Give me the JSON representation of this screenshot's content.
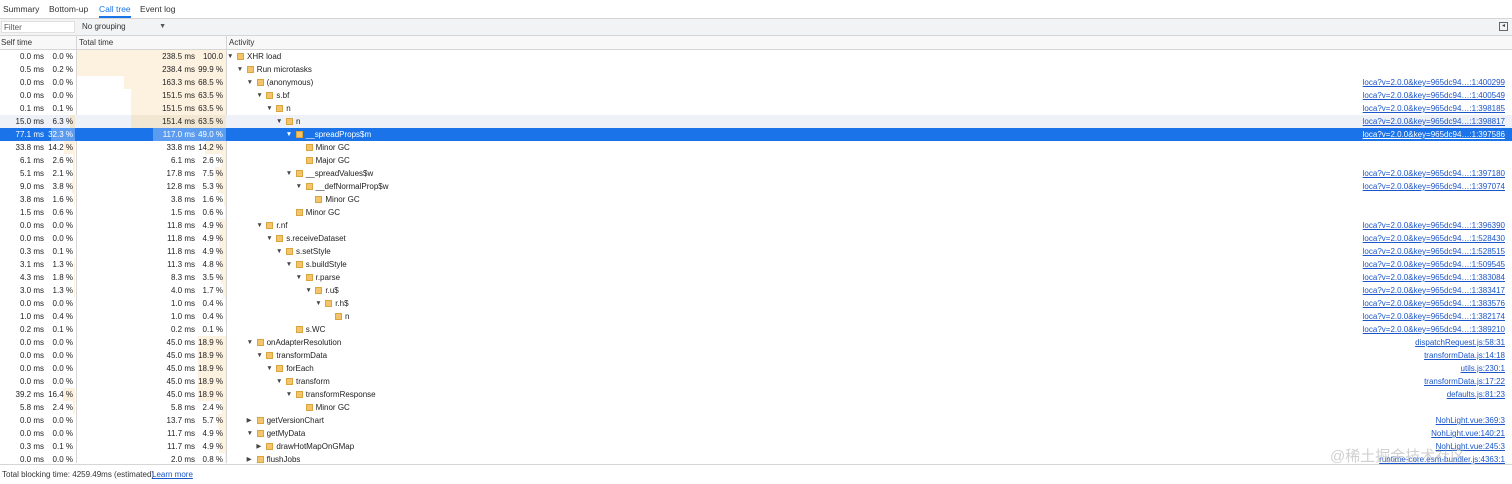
{
  "tabs": [
    {
      "label": "Summary",
      "active": false
    },
    {
      "label": "Bottom-up",
      "active": false
    },
    {
      "label": "Call tree",
      "active": true
    },
    {
      "label": "Event log",
      "active": false
    }
  ],
  "filter": {
    "placeholder": "Filter"
  },
  "grouping": {
    "value": "No grouping"
  },
  "columns": {
    "self": "Self time",
    "total": "Total time",
    "activity": "Activity"
  },
  "rows": [
    {
      "self_ms": "0.0 ms",
      "self_pct": "0.0 %",
      "self_frac": 0,
      "total_ms": "238.5 ms",
      "total_pct": "100.0 %",
      "total_frac": 1.0,
      "depth": 0,
      "expand": "open",
      "name": "XHR load",
      "link": ""
    },
    {
      "self_ms": "0.5 ms",
      "self_pct": "0.2 %",
      "self_frac": 0.002,
      "total_ms": "238.4 ms",
      "total_pct": "99.9 %",
      "total_frac": 0.999,
      "depth": 1,
      "expand": "open",
      "name": "Run microtasks",
      "link": ""
    },
    {
      "self_ms": "0.0 ms",
      "self_pct": "0.0 %",
      "self_frac": 0,
      "total_ms": "163.3 ms",
      "total_pct": "68.5 %",
      "total_frac": 0.685,
      "depth": 2,
      "expand": "open",
      "name": "(anonymous)",
      "link": "loca?v=2.0.0&key=965dc94…:1:400299"
    },
    {
      "self_ms": "0.0 ms",
      "self_pct": "0.0 %",
      "self_frac": 0,
      "total_ms": "151.5 ms",
      "total_pct": "63.5 %",
      "total_frac": 0.635,
      "depth": 3,
      "expand": "open",
      "name": "s.bf",
      "link": "loca?v=2.0.0&key=965dc94…:1:400549"
    },
    {
      "self_ms": "0.1 ms",
      "self_pct": "0.1 %",
      "self_frac": 0.001,
      "total_ms": "151.5 ms",
      "total_pct": "63.5 %",
      "total_frac": 0.635,
      "depth": 4,
      "expand": "open",
      "name": "n",
      "link": "loca?v=2.0.0&key=965dc94…:1:398185"
    },
    {
      "self_ms": "15.0 ms",
      "self_pct": "6.3 %",
      "self_frac": 0.063,
      "total_ms": "151.4 ms",
      "total_pct": "63.5 %",
      "total_frac": 0.635,
      "depth": 5,
      "expand": "open",
      "name": "n",
      "link": "loca?v=2.0.0&key=965dc94…:1:398817",
      "state": "hover"
    },
    {
      "self_ms": "77.1 ms",
      "self_pct": "32.3 %",
      "self_frac": 0.323,
      "total_ms": "117.0 ms",
      "total_pct": "49.0 %",
      "total_frac": 0.49,
      "depth": 6,
      "expand": "open",
      "name": "__spreadProps$m",
      "link": "loca?v=2.0.0&key=965dc94…:1:397586",
      "state": "selected"
    },
    {
      "self_ms": "33.8 ms",
      "self_pct": "14.2 %",
      "self_frac": 0.142,
      "total_ms": "33.8 ms",
      "total_pct": "14.2 %",
      "total_frac": 0.142,
      "depth": 7,
      "expand": "none",
      "name": "Minor GC",
      "link": ""
    },
    {
      "self_ms": "6.1 ms",
      "self_pct": "2.6 %",
      "self_frac": 0.026,
      "total_ms": "6.1 ms",
      "total_pct": "2.6 %",
      "total_frac": 0.026,
      "depth": 7,
      "expand": "none",
      "name": "Major GC",
      "link": ""
    },
    {
      "self_ms": "5.1 ms",
      "self_pct": "2.1 %",
      "self_frac": 0.021,
      "total_ms": "17.8 ms",
      "total_pct": "7.5 %",
      "total_frac": 0.075,
      "depth": 6,
      "expand": "open",
      "name": "__spreadValues$w",
      "link": "loca?v=2.0.0&key=965dc94…:1:397180"
    },
    {
      "self_ms": "9.0 ms",
      "self_pct": "3.8 %",
      "self_frac": 0.038,
      "total_ms": "12.8 ms",
      "total_pct": "5.3 %",
      "total_frac": 0.053,
      "depth": 7,
      "expand": "open",
      "name": "__defNormalProp$w",
      "link": "loca?v=2.0.0&key=965dc94…:1:397074"
    },
    {
      "self_ms": "3.8 ms",
      "self_pct": "1.6 %",
      "self_frac": 0.016,
      "total_ms": "3.8 ms",
      "total_pct": "1.6 %",
      "total_frac": 0.016,
      "depth": 8,
      "expand": "none",
      "name": "Minor GC",
      "link": ""
    },
    {
      "self_ms": "1.5 ms",
      "self_pct": "0.6 %",
      "self_frac": 0.006,
      "total_ms": "1.5 ms",
      "total_pct": "0.6 %",
      "total_frac": 0.006,
      "depth": 6,
      "expand": "none",
      "name": "Minor GC",
      "link": ""
    },
    {
      "self_ms": "0.0 ms",
      "self_pct": "0.0 %",
      "self_frac": 0,
      "total_ms": "11.8 ms",
      "total_pct": "4.9 %",
      "total_frac": 0.049,
      "depth": 3,
      "expand": "open",
      "name": "r.nf",
      "link": "loca?v=2.0.0&key=965dc94…:1:396390"
    },
    {
      "self_ms": "0.0 ms",
      "self_pct": "0.0 %",
      "self_frac": 0,
      "total_ms": "11.8 ms",
      "total_pct": "4.9 %",
      "total_frac": 0.049,
      "depth": 4,
      "expand": "open",
      "name": "s.receiveDataset",
      "link": "loca?v=2.0.0&key=965dc94…:1:528430"
    },
    {
      "self_ms": "0.3 ms",
      "self_pct": "0.1 %",
      "self_frac": 0.001,
      "total_ms": "11.8 ms",
      "total_pct": "4.9 %",
      "total_frac": 0.049,
      "depth": 5,
      "expand": "open",
      "name": "s.setStyle",
      "link": "loca?v=2.0.0&key=965dc94…:1:528515"
    },
    {
      "self_ms": "3.1 ms",
      "self_pct": "1.3 %",
      "self_frac": 0.013,
      "total_ms": "11.3 ms",
      "total_pct": "4.8 %",
      "total_frac": 0.048,
      "depth": 6,
      "expand": "open",
      "name": "s.buildStyle",
      "link": "loca?v=2.0.0&key=965dc94…:1:509545"
    },
    {
      "self_ms": "4.3 ms",
      "self_pct": "1.8 %",
      "self_frac": 0.018,
      "total_ms": "8.3 ms",
      "total_pct": "3.5 %",
      "total_frac": 0.035,
      "depth": 7,
      "expand": "open",
      "name": "r.parse",
      "link": "loca?v=2.0.0&key=965dc94…:1:383084"
    },
    {
      "self_ms": "3.0 ms",
      "self_pct": "1.3 %",
      "self_frac": 0.013,
      "total_ms": "4.0 ms",
      "total_pct": "1.7 %",
      "total_frac": 0.017,
      "depth": 8,
      "expand": "open",
      "name": "r.u$",
      "link": "loca?v=2.0.0&key=965dc94…:1:383417"
    },
    {
      "self_ms": "0.0 ms",
      "self_pct": "0.0 %",
      "self_frac": 0,
      "total_ms": "1.0 ms",
      "total_pct": "0.4 %",
      "total_frac": 0.004,
      "depth": 9,
      "expand": "open",
      "name": "r.h$",
      "link": "loca?v=2.0.0&key=965dc94…:1:383576"
    },
    {
      "self_ms": "1.0 ms",
      "self_pct": "0.4 %",
      "self_frac": 0.004,
      "total_ms": "1.0 ms",
      "total_pct": "0.4 %",
      "total_frac": 0.004,
      "depth": 10,
      "expand": "none",
      "name": "n",
      "link": "loca?v=2.0.0&key=965dc94…:1:382174"
    },
    {
      "self_ms": "0.2 ms",
      "self_pct": "0.1 %",
      "self_frac": 0.001,
      "total_ms": "0.2 ms",
      "total_pct": "0.1 %",
      "total_frac": 0.001,
      "depth": 6,
      "expand": "none",
      "name": "s.WC",
      "link": "loca?v=2.0.0&key=965dc94…:1:389210"
    },
    {
      "self_ms": "0.0 ms",
      "self_pct": "0.0 %",
      "self_frac": 0,
      "total_ms": "45.0 ms",
      "total_pct": "18.9 %",
      "total_frac": 0.189,
      "depth": 2,
      "expand": "open",
      "name": "onAdapterResolution",
      "link": "dispatchRequest.js:58:31"
    },
    {
      "self_ms": "0.0 ms",
      "self_pct": "0.0 %",
      "self_frac": 0,
      "total_ms": "45.0 ms",
      "total_pct": "18.9 %",
      "total_frac": 0.189,
      "depth": 3,
      "expand": "open",
      "name": "transformData",
      "link": "transformData.js:14:18"
    },
    {
      "self_ms": "0.0 ms",
      "self_pct": "0.0 %",
      "self_frac": 0,
      "total_ms": "45.0 ms",
      "total_pct": "18.9 %",
      "total_frac": 0.189,
      "depth": 4,
      "expand": "open",
      "name": "forEach",
      "link": "utils.js:230:1"
    },
    {
      "self_ms": "0.0 ms",
      "self_pct": "0.0 %",
      "self_frac": 0,
      "total_ms": "45.0 ms",
      "total_pct": "18.9 %",
      "total_frac": 0.189,
      "depth": 5,
      "expand": "open",
      "name": "transform",
      "link": "transformData.js:17:22"
    },
    {
      "self_ms": "39.2 ms",
      "self_pct": "16.4 %",
      "self_frac": 0.164,
      "total_ms": "45.0 ms",
      "total_pct": "18.9 %",
      "total_frac": 0.189,
      "depth": 6,
      "expand": "open",
      "name": "transformResponse",
      "link": "defaults.js:81:23"
    },
    {
      "self_ms": "5.8 ms",
      "self_pct": "2.4 %",
      "self_frac": 0.024,
      "total_ms": "5.8 ms",
      "total_pct": "2.4 %",
      "total_frac": 0.024,
      "depth": 7,
      "expand": "none",
      "name": "Minor GC",
      "link": ""
    },
    {
      "self_ms": "0.0 ms",
      "self_pct": "0.0 %",
      "self_frac": 0,
      "total_ms": "13.7 ms",
      "total_pct": "5.7 %",
      "total_frac": 0.057,
      "depth": 2,
      "expand": "closed",
      "name": "getVersionChart",
      "link": "NohLight.vue:369:3"
    },
    {
      "self_ms": "0.0 ms",
      "self_pct": "0.0 %",
      "self_frac": 0,
      "total_ms": "11.7 ms",
      "total_pct": "4.9 %",
      "total_frac": 0.049,
      "depth": 2,
      "expand": "open",
      "name": "getMyData",
      "link": "NohLight.vue:140:21"
    },
    {
      "self_ms": "0.3 ms",
      "self_pct": "0.1 %",
      "self_frac": 0.001,
      "total_ms": "11.7 ms",
      "total_pct": "4.9 %",
      "total_frac": 0.049,
      "depth": 3,
      "expand": "closed",
      "name": "drawHotMapOnGMap",
      "link": "NohLight.vue:245:3"
    },
    {
      "self_ms": "0.0 ms",
      "self_pct": "0.0 %",
      "self_frac": 0,
      "total_ms": "2.0 ms",
      "total_pct": "0.8 %",
      "total_frac": 0.008,
      "depth": 2,
      "expand": "closed",
      "name": "flushJobs",
      "link": "runtime-core.esm-bundler.js:4363:1"
    }
  ],
  "footer": {
    "text": "Total blocking time: 4259.49ms (estimated)",
    "learn_more": "Learn more"
  },
  "watermark": "@稀土掘金技术社区",
  "colors": {
    "accent": "#1a73e8",
    "bar": "#fdf1e0",
    "node": "#f3c46b",
    "link": "#1a55c9"
  }
}
